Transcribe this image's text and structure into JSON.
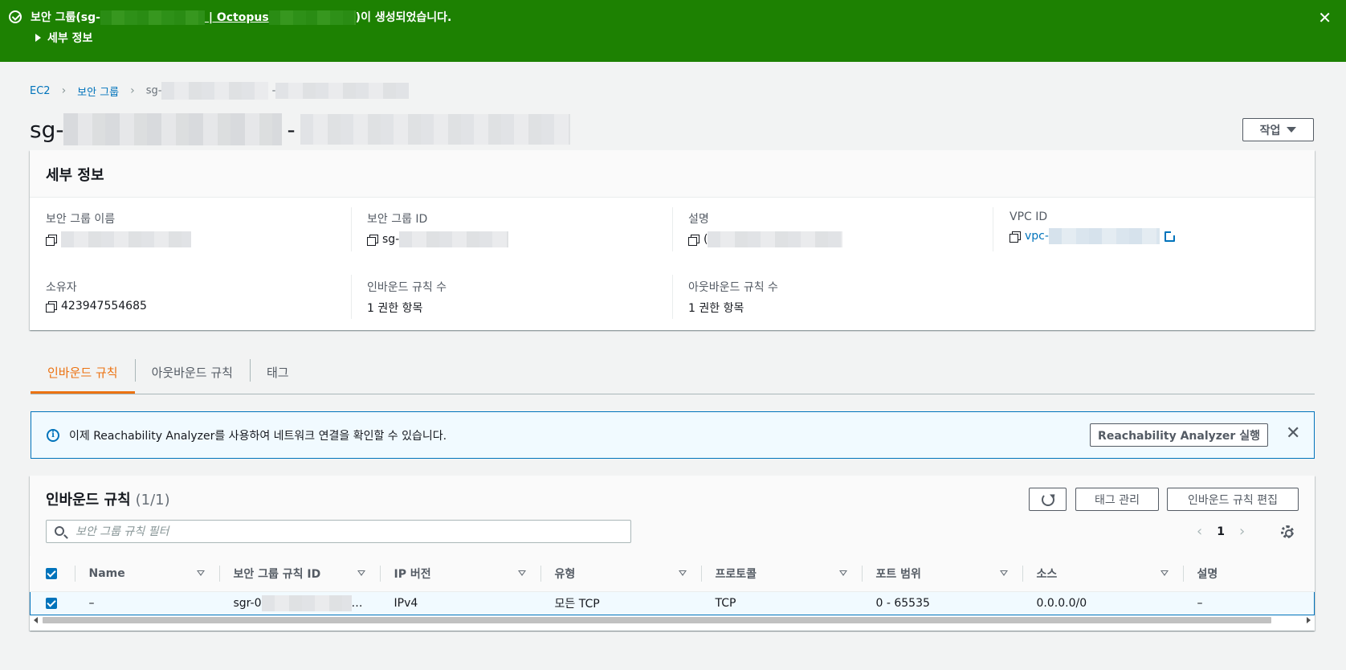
{
  "flash": {
    "message_prefix": "보안 그룹(sg-",
    "message_link": " | Octopus",
    "message_suffix": ")이 생성되었습니다.",
    "details_toggle": "세부 정보",
    "close_glyph": "✕",
    "color": "#1d8102"
  },
  "breadcrumb": {
    "items": [
      "EC2",
      "보안 그룹"
    ],
    "current_prefix": "sg-",
    "current_dash": "-",
    "separator": "›"
  },
  "page": {
    "title_prefix": "sg-",
    "title_dash": "-",
    "actions_label": "작업"
  },
  "details": {
    "heading": "세부 정보",
    "name_label": "보안 그룹 이름",
    "id_label": "보안 그룹 ID",
    "id_value_prefix": "sg-",
    "desc_label": "설명",
    "desc_value_prefix": "(",
    "vpc_label": "VPC ID",
    "vpc_value_prefix": "vpc-",
    "owner_label": "소유자",
    "owner_value": "423947554685",
    "inbound_count_label": "인바운드 규칙 수",
    "inbound_count_value": "1 권한 항목",
    "outbound_count_label": "아웃바운드 규칙 수",
    "outbound_count_value": "1 권한 항목"
  },
  "tabs": [
    {
      "label": "인바운드 규칙",
      "active": true
    },
    {
      "label": "아웃바운드 규칙",
      "active": false
    },
    {
      "label": "태그",
      "active": false
    }
  ],
  "info_alert": {
    "text": "이제 Reachability Analyzer를 사용하여 네트워크 연결을 확인할 수 있습니다.",
    "button_label": "Reachability Analyzer 실행",
    "close_glyph": "✕",
    "info_glyph": "i"
  },
  "rules": {
    "title": "인바운드 규칙",
    "count": "(1/1)",
    "manage_tags_label": "태그 관리",
    "edit_label": "인바운드 규칙 편집",
    "filter_placeholder": "보안 그룹 규칙 필터",
    "page_prev": "‹",
    "page_number": "1",
    "page_next": "›",
    "columns": [
      "Name",
      "보안 그룹 규칙 ID",
      "IP 버전",
      "유형",
      "프로토콜",
      "포트 범위",
      "소스",
      "설명"
    ],
    "rows": [
      {
        "name": "–",
        "rule_id_prefix": "sgr-0",
        "rule_id_suffix": "…",
        "ip_version": "IPv4",
        "type": "모든 TCP",
        "protocol": "TCP",
        "port_range": "0 - 65535",
        "source": "0.0.0.0/0",
        "description": "–"
      }
    ]
  },
  "colors": {
    "link": "#0073bb",
    "accent": "#ec7211",
    "success": "#1d8102"
  }
}
